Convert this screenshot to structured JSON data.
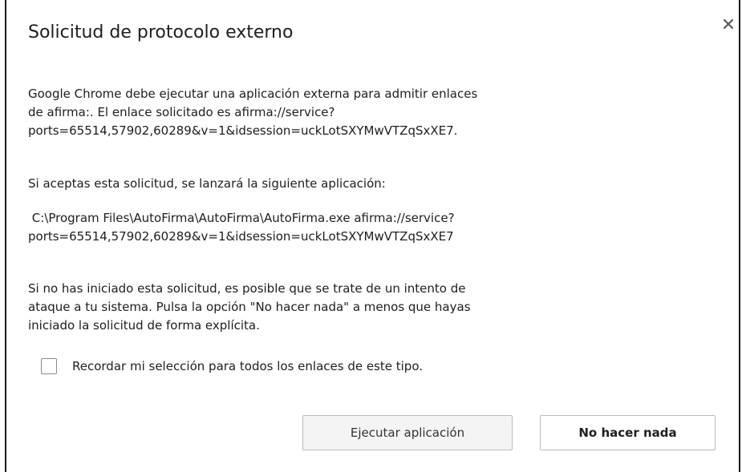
{
  "dialog": {
    "title": "Solicitud de protocolo externo",
    "close_icon": "close-icon",
    "intro_lines": [
      "Google Chrome debe ejecutar una aplicación externa para admitir enlaces",
      "de afirma:. El enlace solicitado es afirma://service?",
      "ports=65514,57902,60289&v=1&idsession=uckLotSXYMwVTZqSxXE7."
    ],
    "accept_text": "Si aceptas esta solicitud, se lanzará la siguiente aplicación:",
    "command_lines": [
      " C:\\Program Files\\AutoFirma\\AutoFirma\\AutoFirma.exe afirma://service?",
      "ports=65514,57902,60289&v=1&idsession=uckLotSXYMwVTZqSxXE7"
    ],
    "warning_lines": [
      "Si no has iniciado esta solicitud, es posible que se trate de un intento de",
      "ataque a tu sistema. Pulsa la opción \"No hacer nada\" a menos que hayas",
      "iniciado la solicitud de forma explícita."
    ],
    "remember_label": "Recordar mi selección para todos los enlaces de este tipo.",
    "buttons": {
      "run": "Ejecutar aplicación",
      "nothing": "No hacer nada"
    }
  }
}
